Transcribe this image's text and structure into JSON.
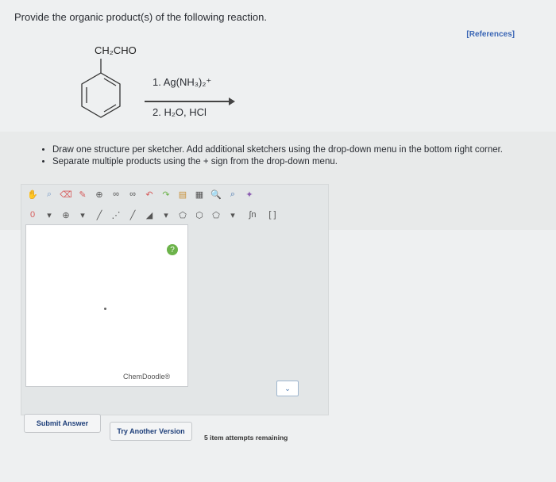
{
  "question": {
    "prompt": "Provide the organic product(s) of the following reaction.",
    "references_link": "[References]"
  },
  "reaction": {
    "substituent": "CH₂CHO",
    "reagent_1": "1. Ag(NH₃)₂⁺",
    "reagent_2": "2. H₂O, HCl"
  },
  "instructions": [
    "Draw one structure per sketcher. Add additional sketchers using the drop-down menu in the bottom right corner.",
    "Separate multiple products using the + sign from the drop-down menu."
  ],
  "sketcher": {
    "charge_label": "0",
    "brand": "ChemDoodle®",
    "help": "?"
  },
  "buttons": {
    "submit": "Submit Answer",
    "try_another": "Try Another Version"
  },
  "status": {
    "attempts": "5 item attempts remaining"
  }
}
